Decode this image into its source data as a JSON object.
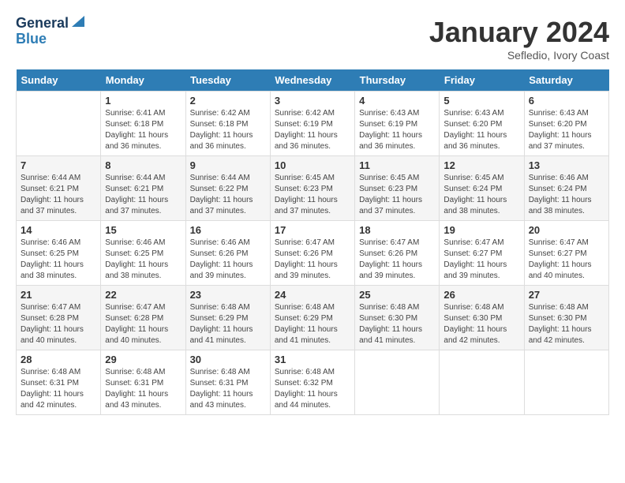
{
  "header": {
    "logo_line1": "General",
    "logo_line2": "Blue",
    "month_title": "January 2024",
    "subtitle": "Sefledio, Ivory Coast"
  },
  "days_of_week": [
    "Sunday",
    "Monday",
    "Tuesday",
    "Wednesday",
    "Thursday",
    "Friday",
    "Saturday"
  ],
  "weeks": [
    [
      {
        "day": "",
        "info": ""
      },
      {
        "day": "1",
        "info": "Sunrise: 6:41 AM\nSunset: 6:18 PM\nDaylight: 11 hours\nand 36 minutes."
      },
      {
        "day": "2",
        "info": "Sunrise: 6:42 AM\nSunset: 6:18 PM\nDaylight: 11 hours\nand 36 minutes."
      },
      {
        "day": "3",
        "info": "Sunrise: 6:42 AM\nSunset: 6:19 PM\nDaylight: 11 hours\nand 36 minutes."
      },
      {
        "day": "4",
        "info": "Sunrise: 6:43 AM\nSunset: 6:19 PM\nDaylight: 11 hours\nand 36 minutes."
      },
      {
        "day": "5",
        "info": "Sunrise: 6:43 AM\nSunset: 6:20 PM\nDaylight: 11 hours\nand 36 minutes."
      },
      {
        "day": "6",
        "info": "Sunrise: 6:43 AM\nSunset: 6:20 PM\nDaylight: 11 hours\nand 37 minutes."
      }
    ],
    [
      {
        "day": "7",
        "info": "Sunrise: 6:44 AM\nSunset: 6:21 PM\nDaylight: 11 hours\nand 37 minutes."
      },
      {
        "day": "8",
        "info": "Sunrise: 6:44 AM\nSunset: 6:21 PM\nDaylight: 11 hours\nand 37 minutes."
      },
      {
        "day": "9",
        "info": "Sunrise: 6:44 AM\nSunset: 6:22 PM\nDaylight: 11 hours\nand 37 minutes."
      },
      {
        "day": "10",
        "info": "Sunrise: 6:45 AM\nSunset: 6:23 PM\nDaylight: 11 hours\nand 37 minutes."
      },
      {
        "day": "11",
        "info": "Sunrise: 6:45 AM\nSunset: 6:23 PM\nDaylight: 11 hours\nand 37 minutes."
      },
      {
        "day": "12",
        "info": "Sunrise: 6:45 AM\nSunset: 6:24 PM\nDaylight: 11 hours\nand 38 minutes."
      },
      {
        "day": "13",
        "info": "Sunrise: 6:46 AM\nSunset: 6:24 PM\nDaylight: 11 hours\nand 38 minutes."
      }
    ],
    [
      {
        "day": "14",
        "info": "Sunrise: 6:46 AM\nSunset: 6:25 PM\nDaylight: 11 hours\nand 38 minutes."
      },
      {
        "day": "15",
        "info": "Sunrise: 6:46 AM\nSunset: 6:25 PM\nDaylight: 11 hours\nand 38 minutes."
      },
      {
        "day": "16",
        "info": "Sunrise: 6:46 AM\nSunset: 6:26 PM\nDaylight: 11 hours\nand 39 minutes."
      },
      {
        "day": "17",
        "info": "Sunrise: 6:47 AM\nSunset: 6:26 PM\nDaylight: 11 hours\nand 39 minutes."
      },
      {
        "day": "18",
        "info": "Sunrise: 6:47 AM\nSunset: 6:26 PM\nDaylight: 11 hours\nand 39 minutes."
      },
      {
        "day": "19",
        "info": "Sunrise: 6:47 AM\nSunset: 6:27 PM\nDaylight: 11 hours\nand 39 minutes."
      },
      {
        "day": "20",
        "info": "Sunrise: 6:47 AM\nSunset: 6:27 PM\nDaylight: 11 hours\nand 40 minutes."
      }
    ],
    [
      {
        "day": "21",
        "info": "Sunrise: 6:47 AM\nSunset: 6:28 PM\nDaylight: 11 hours\nand 40 minutes."
      },
      {
        "day": "22",
        "info": "Sunrise: 6:47 AM\nSunset: 6:28 PM\nDaylight: 11 hours\nand 40 minutes."
      },
      {
        "day": "23",
        "info": "Sunrise: 6:48 AM\nSunset: 6:29 PM\nDaylight: 11 hours\nand 41 minutes."
      },
      {
        "day": "24",
        "info": "Sunrise: 6:48 AM\nSunset: 6:29 PM\nDaylight: 11 hours\nand 41 minutes."
      },
      {
        "day": "25",
        "info": "Sunrise: 6:48 AM\nSunset: 6:30 PM\nDaylight: 11 hours\nand 41 minutes."
      },
      {
        "day": "26",
        "info": "Sunrise: 6:48 AM\nSunset: 6:30 PM\nDaylight: 11 hours\nand 42 minutes."
      },
      {
        "day": "27",
        "info": "Sunrise: 6:48 AM\nSunset: 6:30 PM\nDaylight: 11 hours\nand 42 minutes."
      }
    ],
    [
      {
        "day": "28",
        "info": "Sunrise: 6:48 AM\nSunset: 6:31 PM\nDaylight: 11 hours\nand 42 minutes."
      },
      {
        "day": "29",
        "info": "Sunrise: 6:48 AM\nSunset: 6:31 PM\nDaylight: 11 hours\nand 43 minutes."
      },
      {
        "day": "30",
        "info": "Sunrise: 6:48 AM\nSunset: 6:31 PM\nDaylight: 11 hours\nand 43 minutes."
      },
      {
        "day": "31",
        "info": "Sunrise: 6:48 AM\nSunset: 6:32 PM\nDaylight: 11 hours\nand 44 minutes."
      },
      {
        "day": "",
        "info": ""
      },
      {
        "day": "",
        "info": ""
      },
      {
        "day": "",
        "info": ""
      }
    ]
  ]
}
